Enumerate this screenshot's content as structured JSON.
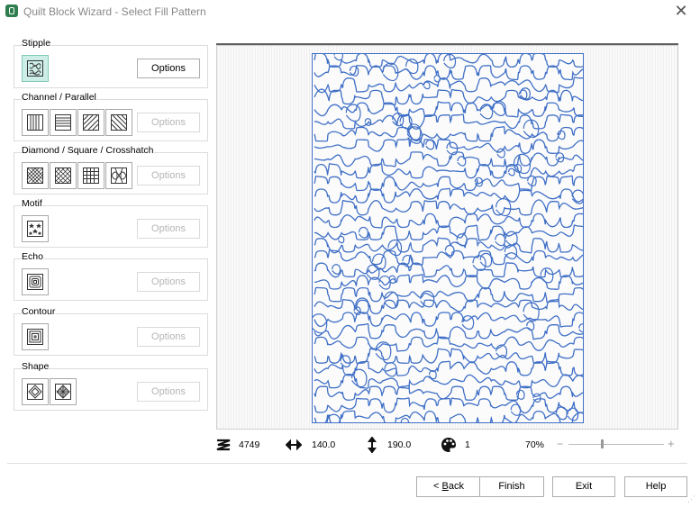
{
  "window": {
    "title": "Quilt Block Wizard - Select Fill Pattern",
    "close_glyph": "✕"
  },
  "groups": {
    "stipple": {
      "title": "Stipple",
      "options_label": "Options"
    },
    "channel": {
      "title": "Channel / Parallel",
      "options_label": "Options"
    },
    "diamond": {
      "title": "Diamond / Square / Crosshatch",
      "options_label": "Options"
    },
    "motif": {
      "title": "Motif",
      "options_label": "Options"
    },
    "echo": {
      "title": "Echo",
      "options_label": "Options"
    },
    "contour": {
      "title": "Contour",
      "options_label": "Options"
    },
    "shape": {
      "title": "Shape",
      "options_label": "Options"
    }
  },
  "status": {
    "stitch_count": "4749",
    "width": "140.0",
    "height": "190.0",
    "colors": "1",
    "zoom": "70%",
    "zoom_level": 0.35,
    "zoom_minus": "−",
    "zoom_plus": "+"
  },
  "buttons": {
    "back_prefix": "< ",
    "back_key": "B",
    "back_suffix": "ack",
    "finish": "Finish",
    "exit": "Exit",
    "help": "Help"
  },
  "colors": {
    "accent": "#2e7d4f",
    "selected_tile": "#cdeee6",
    "stitch": "#3f6fc6"
  },
  "icons": [
    "quilt-app-icon",
    "stitch-count-icon",
    "width-arrows-icon",
    "height-arrows-icon",
    "palette-icon"
  ]
}
